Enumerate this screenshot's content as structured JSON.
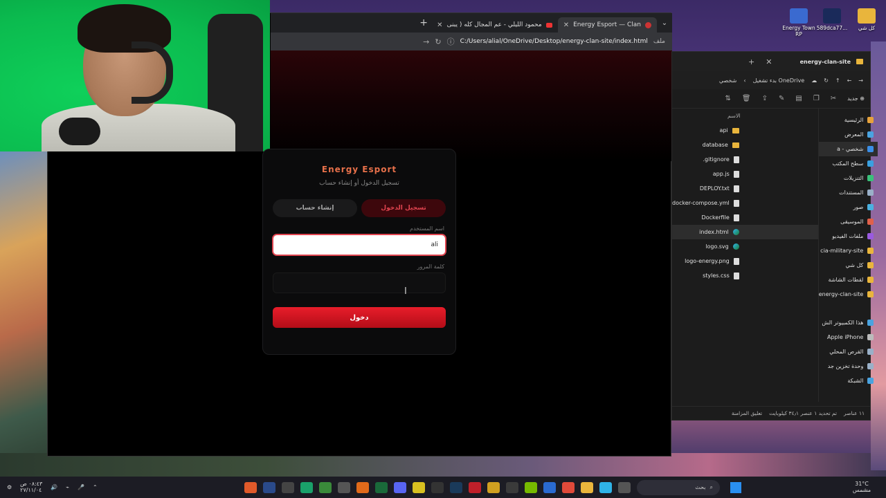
{
  "browser": {
    "tabs": [
      {
        "title": "Energy Esport — Clan",
        "active": true
      },
      {
        "title": "محمود الليلي - عم المجال كله ( يبنى",
        "active": false
      }
    ],
    "new_tab": "+",
    "tab_menu": "⌄",
    "address_label": "ملف",
    "url": "C:/Users/alial/OneDrive/Desktop/energy-clan-site/index.html"
  },
  "login": {
    "brand": "Energy Esport",
    "subtitle": "تسجيل الدخول أو إنشاء حساب",
    "tab_login": "تسجيل الدخول",
    "tab_signup": "إنشاء حساب",
    "username_label": "اسم المستخدم",
    "username_value": "ali",
    "password_label": "كلمة المرور",
    "password_value": "",
    "submit": "دخول"
  },
  "explorer": {
    "title": "energy-clan-site",
    "nav_path": "بدء تشغيل OneDrive",
    "nav_path_2": "شخصي",
    "new_label": "جديد",
    "column_name": "الاسم",
    "files": [
      {
        "name": "api",
        "type": "folder"
      },
      {
        "name": "database",
        "type": "folder"
      },
      {
        "name": ".gitignore",
        "type": "file"
      },
      {
        "name": "app.js",
        "type": "file"
      },
      {
        "name": "DEPLOY.txt",
        "type": "file"
      },
      {
        "name": "docker-compose.yml",
        "type": "file"
      },
      {
        "name": "Dockerfile",
        "type": "file"
      },
      {
        "name": "index.html",
        "type": "edge"
      },
      {
        "name": "logo.svg",
        "type": "edge"
      },
      {
        "name": "logo-energy.png",
        "type": "file"
      },
      {
        "name": "styles.css",
        "type": "file"
      }
    ],
    "sidebar": [
      {
        "label": "الرئيسية",
        "color": "#e6a23c"
      },
      {
        "label": "المعرض",
        "color": "#4aa3e0"
      },
      {
        "label": "a - شخصي",
        "color": "#3a8ee6"
      },
      {
        "label": "سطح المكتب",
        "color": "#3aa0e0"
      },
      {
        "label": "التنزيلات",
        "color": "#3ac07a"
      },
      {
        "label": "المستندات",
        "color": "#9ab0c8"
      },
      {
        "label": "صور",
        "color": "#4ab0e0"
      },
      {
        "label": "الموسيقى",
        "color": "#e0604a"
      },
      {
        "label": "ملفات الفيديو",
        "color": "#9a5ae0"
      },
      {
        "label": "cia-military-site",
        "color": "#e9b53c"
      },
      {
        "label": "كل شي",
        "color": "#e9b53c"
      },
      {
        "label": "لقطات الشاشة",
        "color": "#e9b53c"
      },
      {
        "label": "energy-clan-site",
        "color": "#e9b53c"
      },
      {
        "label": "هذا الكمبيوتر الش",
        "color": "#4aa3e0"
      },
      {
        "label": "Apple iPhone",
        "color": "#bbbbbb"
      },
      {
        "label": "القرص المحلي",
        "color": "#9ab0c8"
      },
      {
        "label": "وحدة تخزين جد",
        "color": "#9ab0c8"
      },
      {
        "label": "الشبكة",
        "color": "#4aa3e0"
      }
    ],
    "status": {
      "count": "١١ عناصر",
      "selection": "تم تحديد ١ عنصر ٣٤٫١ كيلوبايت",
      "sync": "تعليق المزامنة"
    }
  },
  "desktop_icons": [
    {
      "label": "Energy Town RP",
      "color": "#3a6ad0"
    },
    {
      "label": "589dca77...",
      "color": "#1a2a5a"
    },
    {
      "label": "كل شي",
      "color": "#e9b53c"
    }
  ],
  "taskbar": {
    "search_placeholder": "بحث",
    "weather_temp": "31°C",
    "weather_text": "مشمس",
    "time": "٠٨:٤٣ ص",
    "date": "٢٧/١١/٠٤"
  }
}
